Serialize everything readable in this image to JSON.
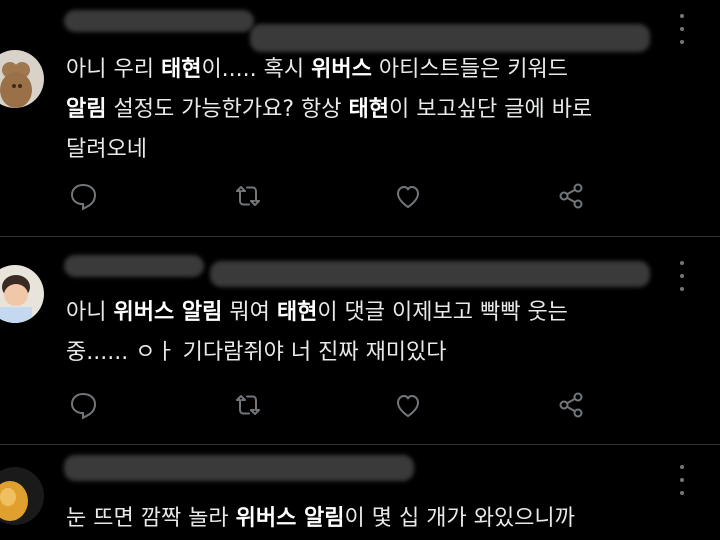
{
  "tweets": [
    {
      "text_lines": [
        [
          {
            "t": "아니 우리 ",
            "b": false
          },
          {
            "t": "태현",
            "b": true
          },
          {
            "t": "이..... 혹시 ",
            "b": false
          },
          {
            "t": "위버스",
            "b": true
          },
          {
            "t": " 아티스트들은 키워드",
            "b": false
          }
        ],
        [
          {
            "t": "알림",
            "b": true
          },
          {
            "t": " 설정도 가능한가요? 항상 ",
            "b": false
          },
          {
            "t": "태현",
            "b": true
          },
          {
            "t": "이 보고싶단 글에 바로",
            "b": false
          }
        ],
        [
          {
            "t": "달려오네",
            "b": false
          }
        ]
      ],
      "actions": [
        "reply-icon",
        "retweet-icon",
        "like-icon",
        "share-icon"
      ]
    },
    {
      "text_lines": [
        [
          {
            "t": "아니 ",
            "b": false
          },
          {
            "t": "위버스 알림",
            "b": true
          },
          {
            "t": " 뭐여 ",
            "b": false
          },
          {
            "t": "태현",
            "b": true
          },
          {
            "t": "이 댓글 이제보고 빡빡 웃는",
            "b": false
          }
        ],
        [
          {
            "t": "중...... ㅇㅏ 기다람쥐야 너 진짜 재미있다",
            "b": false
          }
        ]
      ],
      "actions": [
        "reply-icon",
        "retweet-icon",
        "like-icon",
        "share-icon"
      ]
    },
    {
      "text_lines": [
        [
          {
            "t": "눈 뜨면 깜짝 놀라 ",
            "b": false
          },
          {
            "t": "위버스 알림",
            "b": true
          },
          {
            "t": "이 몇 십 개가 와있으니까",
            "b": false
          }
        ]
      ],
      "actions": []
    }
  ],
  "colors": {
    "background": "#000000",
    "text": "#e7e9ea",
    "icon": "#71767b",
    "divider": "#2f3336"
  }
}
